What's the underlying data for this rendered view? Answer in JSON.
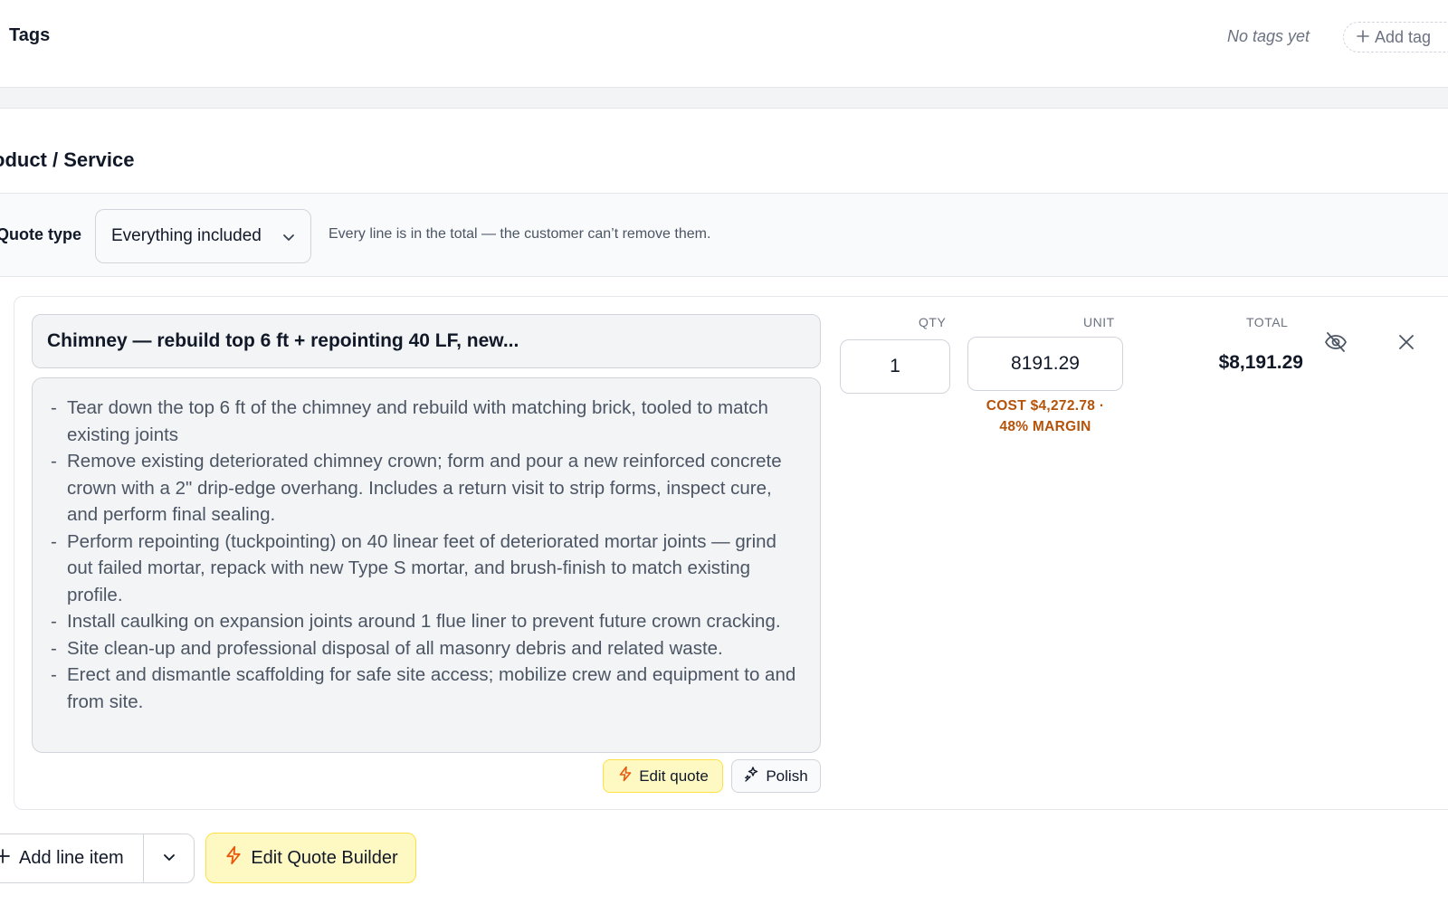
{
  "tags": {
    "title": "Tags",
    "empty_text": "No tags yet",
    "add_label": "Add tag"
  },
  "section": {
    "title": "oduct / Service"
  },
  "quote_type": {
    "label": "Quote type",
    "selected": "Everything included",
    "help": "Every line is in the total — the customer can’t remove them."
  },
  "line_item": {
    "title": "Chimney — rebuild top 6 ft + repointing 40 LF, new...",
    "description": [
      "Tear down the top 6 ft of the chimney and rebuild with matching brick, tooled to match existing joints",
      "Remove existing deteriorated chimney crown; form and pour a new reinforced concrete crown with a 2\" drip-edge overhang. Includes a return visit to strip forms, inspect cure, and perform final sealing.",
      "Perform repointing (tuckpointing) on 40 linear feet of deteriorated mortar joints — grind out failed mortar, repack with new Type S mortar, and brush-finish to match existing profile.",
      "Install caulking on expansion joints around 1 flue liner to prevent future crown cracking.",
      "Site clean-up and professional disposal of all masonry debris and related waste.",
      "Erect and dismantle scaffolding for safe site access; mobilize crew and equipment to and from site."
    ],
    "qty_label": "QTY",
    "unit_label": "UNIT",
    "total_label": "TOTAL",
    "qty": "1",
    "unit": "8191.29",
    "cost_line1": "COST $4,272.78 ·",
    "cost_line2": "48% MARGIN",
    "total": "$8,191.29",
    "edit_quote_label": "Edit quote",
    "polish_label": "Polish"
  },
  "actions": {
    "add_line_label": "Add line item",
    "edit_builder_label": "Edit Quote Builder"
  },
  "colors": {
    "accent_yellow_bg": "#fef9c3",
    "accent_yellow_border": "#fde047",
    "margin_text": "#b45309",
    "icon_orange": "#ea580c"
  },
  "icons": {
    "add_tag": "plus-icon",
    "select": "chevron-down-icon",
    "visibility": "eye-off-icon",
    "remove": "close-icon",
    "edit_quote": "lightning-icon",
    "polish": "sparkles-icon"
  }
}
